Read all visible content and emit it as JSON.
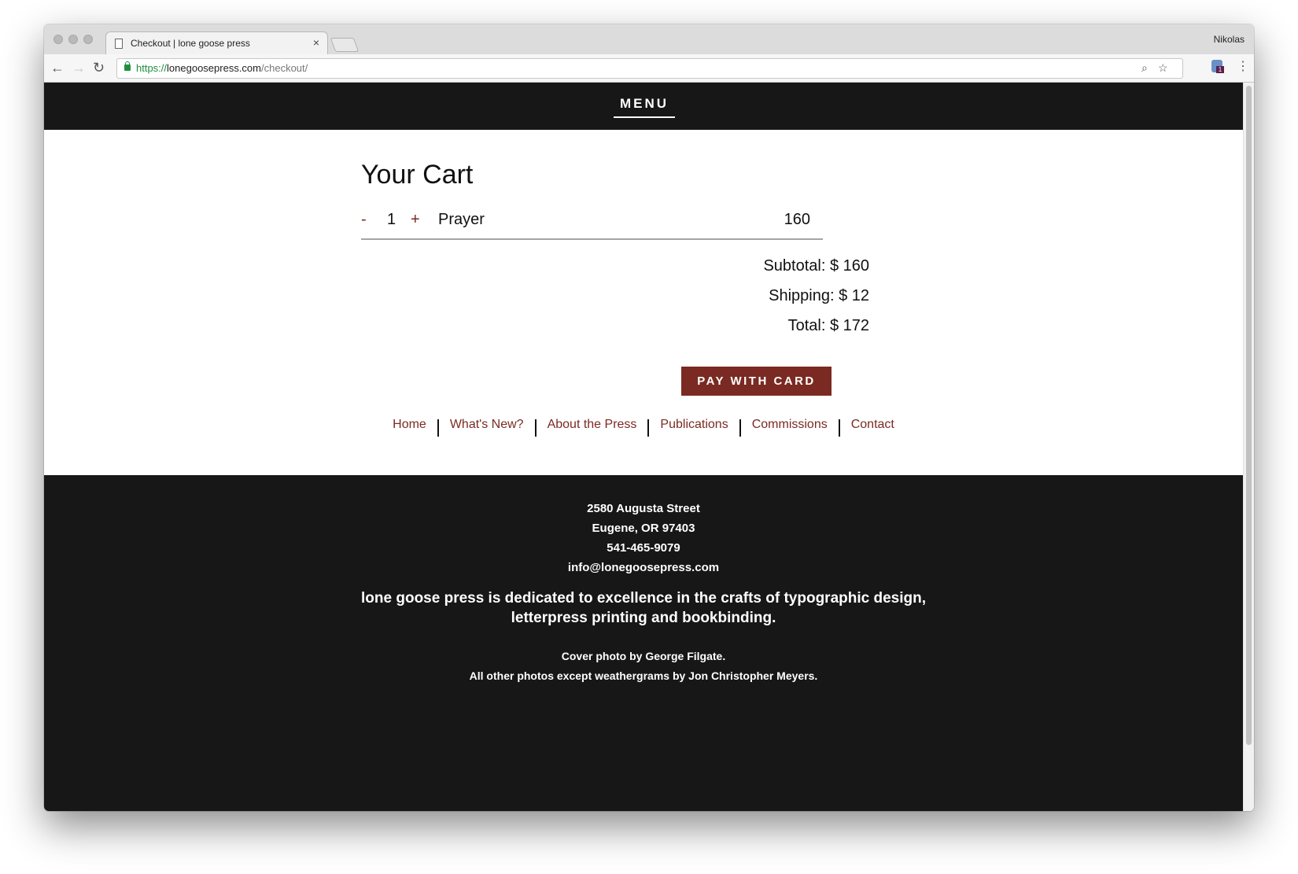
{
  "browser": {
    "tab_title": "Checkout | lone goose press",
    "tab_close": "×",
    "profile_name": "Nikolas",
    "url_scheme": "https://",
    "url_host": "lonegoosepress.com",
    "url_path": "/checkout/",
    "ext_badge": "1",
    "icons": {
      "back": "←",
      "forward": "→",
      "reload": "↻",
      "zoom": "⌕",
      "star": "☆",
      "menu": "⋮"
    }
  },
  "header": {
    "menu_label": "MENU"
  },
  "cart": {
    "title": "Your Cart",
    "item": {
      "minus": "-",
      "quantity": "1",
      "plus": "+",
      "name": "Prayer",
      "price": "160"
    },
    "subtotal": "Subtotal: $ 160",
    "shipping": "Shipping: $ 12",
    "total": "Total: $ 172",
    "pay_button": "PAY WITH CARD"
  },
  "footer_nav": {
    "links": [
      "Home",
      "What's New?",
      "About the Press",
      "Publications",
      "Commissions",
      "Contact"
    ]
  },
  "footer": {
    "address_line1": "2580 Augusta Street",
    "address_line2": "Eugene, OR 97403",
    "phone": "541-465-9079",
    "email": "info@lonegoosepress.com",
    "mission_line1": "lone goose press is dedicated to excellence in the crafts of typographic design,",
    "mission_line2": "letterpress printing and bookbinding.",
    "credit_line1": "Cover photo by George Filgate.",
    "credit_line2": "All other photos except weathergrams by Jon Christopher Meyers."
  },
  "colors": {
    "accent": "#7a2a22",
    "dark": "#171717"
  }
}
